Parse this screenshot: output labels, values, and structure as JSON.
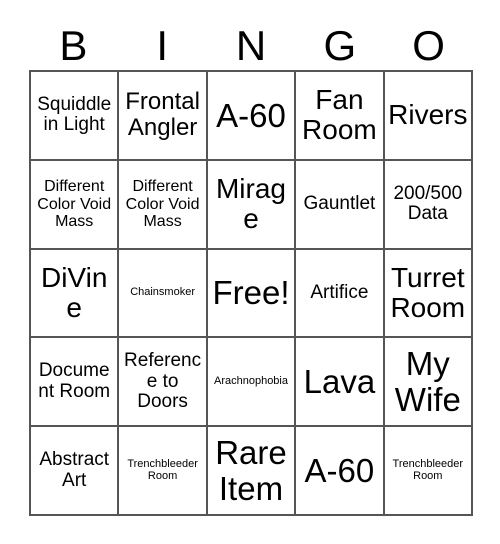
{
  "card": {
    "title": "Bingo Card",
    "header_letters": [
      "B",
      "I",
      "N",
      "G",
      "O"
    ],
    "grid_size": "5x5",
    "colors": {
      "background": "#ffffff",
      "border": "#555555",
      "text": "#000000"
    },
    "rows": [
      [
        {
          "label": "Squiddle in Light",
          "size": "md"
        },
        {
          "label": "Frontal Angler",
          "size": "lg"
        },
        {
          "label": "A-60",
          "size": "xxl"
        },
        {
          "label": "Fan Room",
          "size": "xl"
        },
        {
          "label": "Rivers",
          "size": "xl"
        }
      ],
      [
        {
          "label": "Different Color Void Mass",
          "size": "sm"
        },
        {
          "label": "Different Color Void Mass",
          "size": "sm"
        },
        {
          "label": "Mirage",
          "size": "xl"
        },
        {
          "label": "Gauntlet",
          "size": "md"
        },
        {
          "label": "200/500 Data",
          "size": "md"
        }
      ],
      [
        {
          "label": "DiVine",
          "size": "xl"
        },
        {
          "label": "Chainsmoker",
          "size": "xs"
        },
        {
          "label": "Free!",
          "size": "xxl"
        },
        {
          "label": "Artifice",
          "size": "md"
        },
        {
          "label": "Turret Room",
          "size": "xl"
        }
      ],
      [
        {
          "label": "Document Room",
          "size": "md"
        },
        {
          "label": "Reference to Doors",
          "size": "md"
        },
        {
          "label": "Arachnophobia",
          "size": "xs"
        },
        {
          "label": "Lava",
          "size": "xxl"
        },
        {
          "label": "My Wife",
          "size": "xxl"
        }
      ],
      [
        {
          "label": "Abstract Art",
          "size": "md"
        },
        {
          "label": "Trenchbleeder Room",
          "size": "xs"
        },
        {
          "label": "Rare Item",
          "size": "xxl"
        },
        {
          "label": "A-60",
          "size": "xxl"
        },
        {
          "label": "Trenchbleeder Room",
          "size": "xs"
        }
      ]
    ]
  }
}
